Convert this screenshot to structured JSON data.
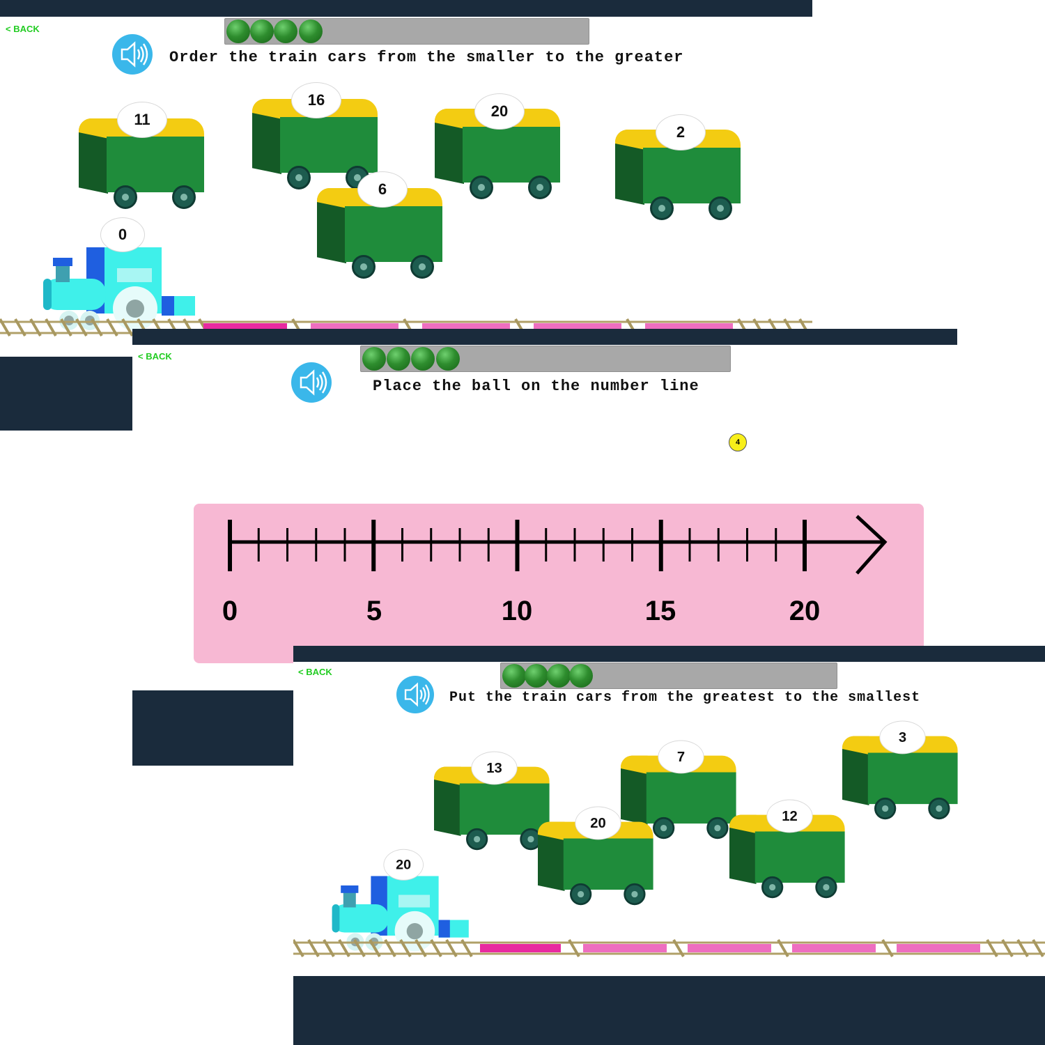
{
  "screens": [
    {
      "back_label": "< BACK",
      "progress_balls": 4,
      "instruction": "Order the train cars from the smaller to the greater",
      "engine_value": "0",
      "cars": [
        "11",
        "16",
        "20",
        "6",
        "2"
      ],
      "icons": [
        "speaker-icon",
        "engine-icon"
      ]
    },
    {
      "back_label": "< BACK",
      "progress_balls": 4,
      "instruction": "Place the ball on the number line",
      "ball_value": "4",
      "number_line": {
        "min": 0,
        "max": 20,
        "minor_step": 1,
        "major_step": 5,
        "labels": [
          "0",
          "5",
          "10",
          "15",
          "20"
        ]
      }
    },
    {
      "back_label": "< BACK",
      "progress_balls": 4,
      "instruction": "Put the train cars from the greatest to the smallest",
      "engine_value": "20",
      "cars": [
        "13",
        "7",
        "3",
        "20",
        "12"
      ]
    }
  ],
  "colors": {
    "navy": "#1a2b3c",
    "back_green": "#22cc22",
    "car_body": "#1f8c3b",
    "car_roof": "#f3cc12",
    "number_line_bg": "#f7b8d3",
    "track_slot": "#e83aa8",
    "speaker": "#3ab7ea"
  }
}
